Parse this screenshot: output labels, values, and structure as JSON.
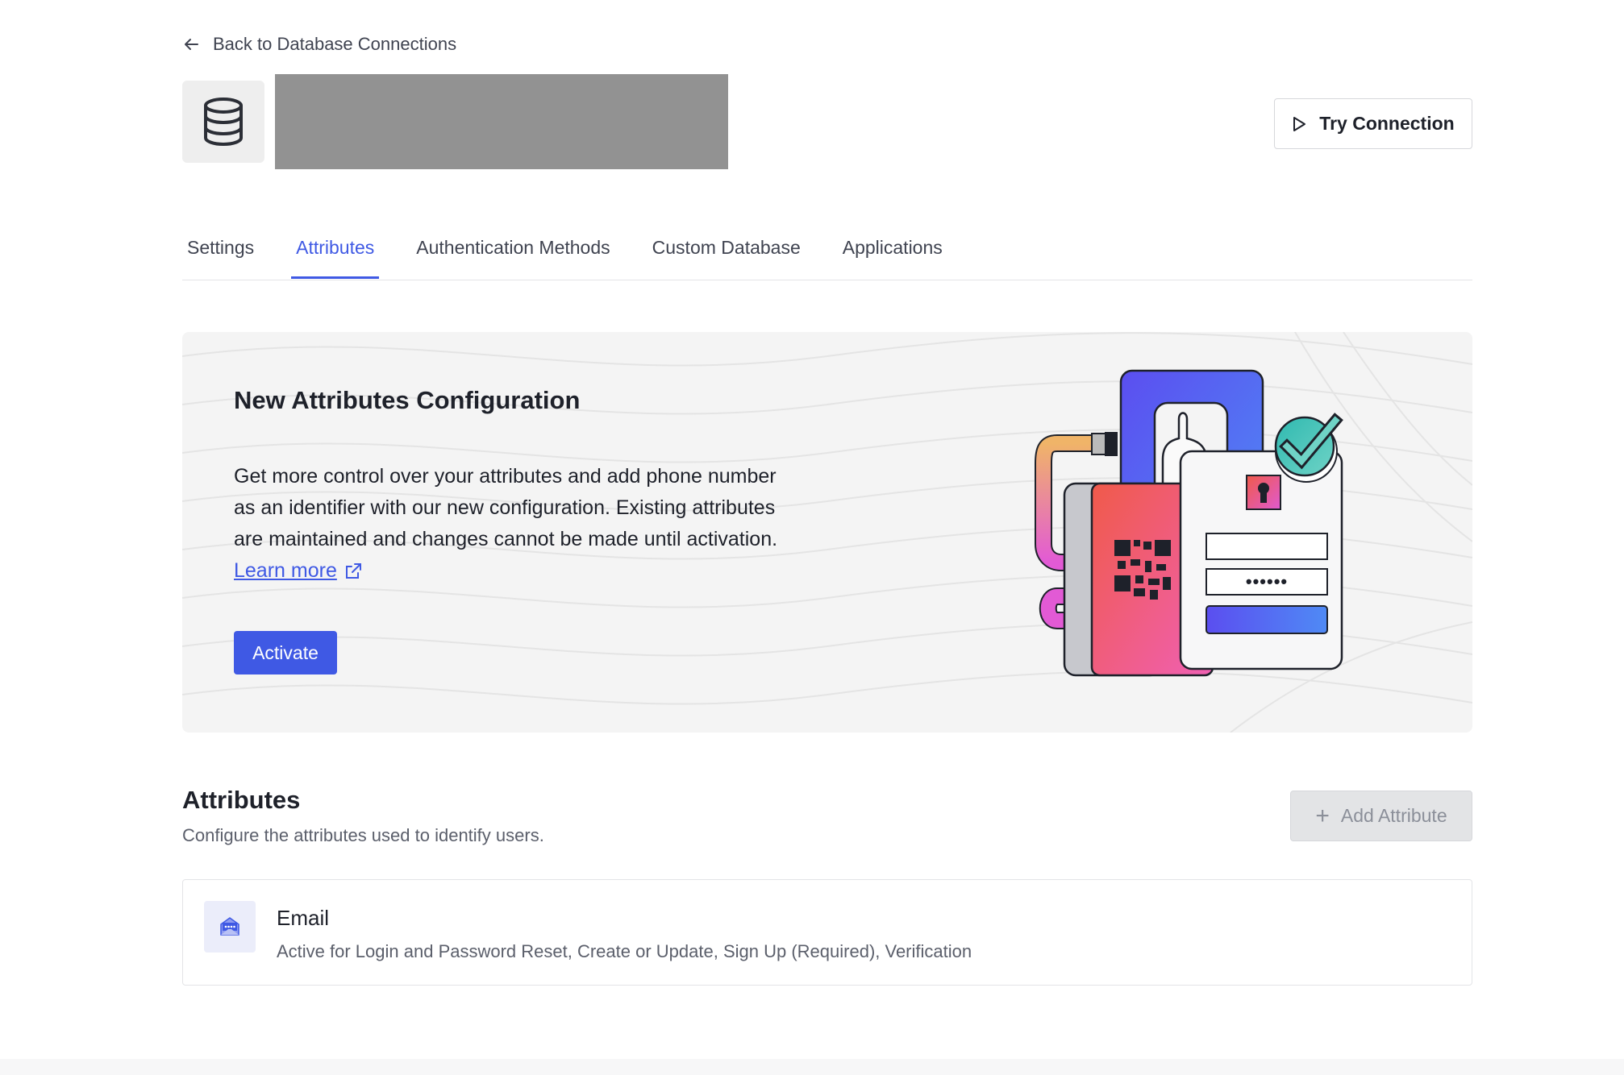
{
  "nav": {
    "back_label": "Back to Database Connections"
  },
  "header": {
    "try_connection_label": "Try Connection"
  },
  "tabs": [
    {
      "label": "Settings",
      "active": false
    },
    {
      "label": "Attributes",
      "active": true
    },
    {
      "label": "Authentication Methods",
      "active": false
    },
    {
      "label": "Custom Database",
      "active": false
    },
    {
      "label": "Applications",
      "active": false
    }
  ],
  "banner": {
    "title": "New Attributes Configuration",
    "body_line1": "Get more control over your attributes and add phone number",
    "body_line2": "as an identifier with our new configuration. Existing attributes",
    "body_line3": "are maintained and changes cannot be made until activation.",
    "learn_more_label": "Learn more",
    "activate_label": "Activate",
    "illustration_password_mask": "••••••"
  },
  "attributes_section": {
    "title": "Attributes",
    "subtitle": "Configure the attributes used to identify users.",
    "add_button_label": "Add Attribute",
    "add_button_icon": "+",
    "items": [
      {
        "name": "Email",
        "description": "Active for Login and Password Reset, Create or Update, Sign Up (Required), Verification",
        "icon": "email-icon"
      }
    ]
  },
  "colors": {
    "accent": "#3f59e4",
    "text_primary": "#1e212a",
    "text_secondary": "#5b5f6b",
    "banner_bg": "#f4f4f4",
    "redacted": "#929292"
  }
}
